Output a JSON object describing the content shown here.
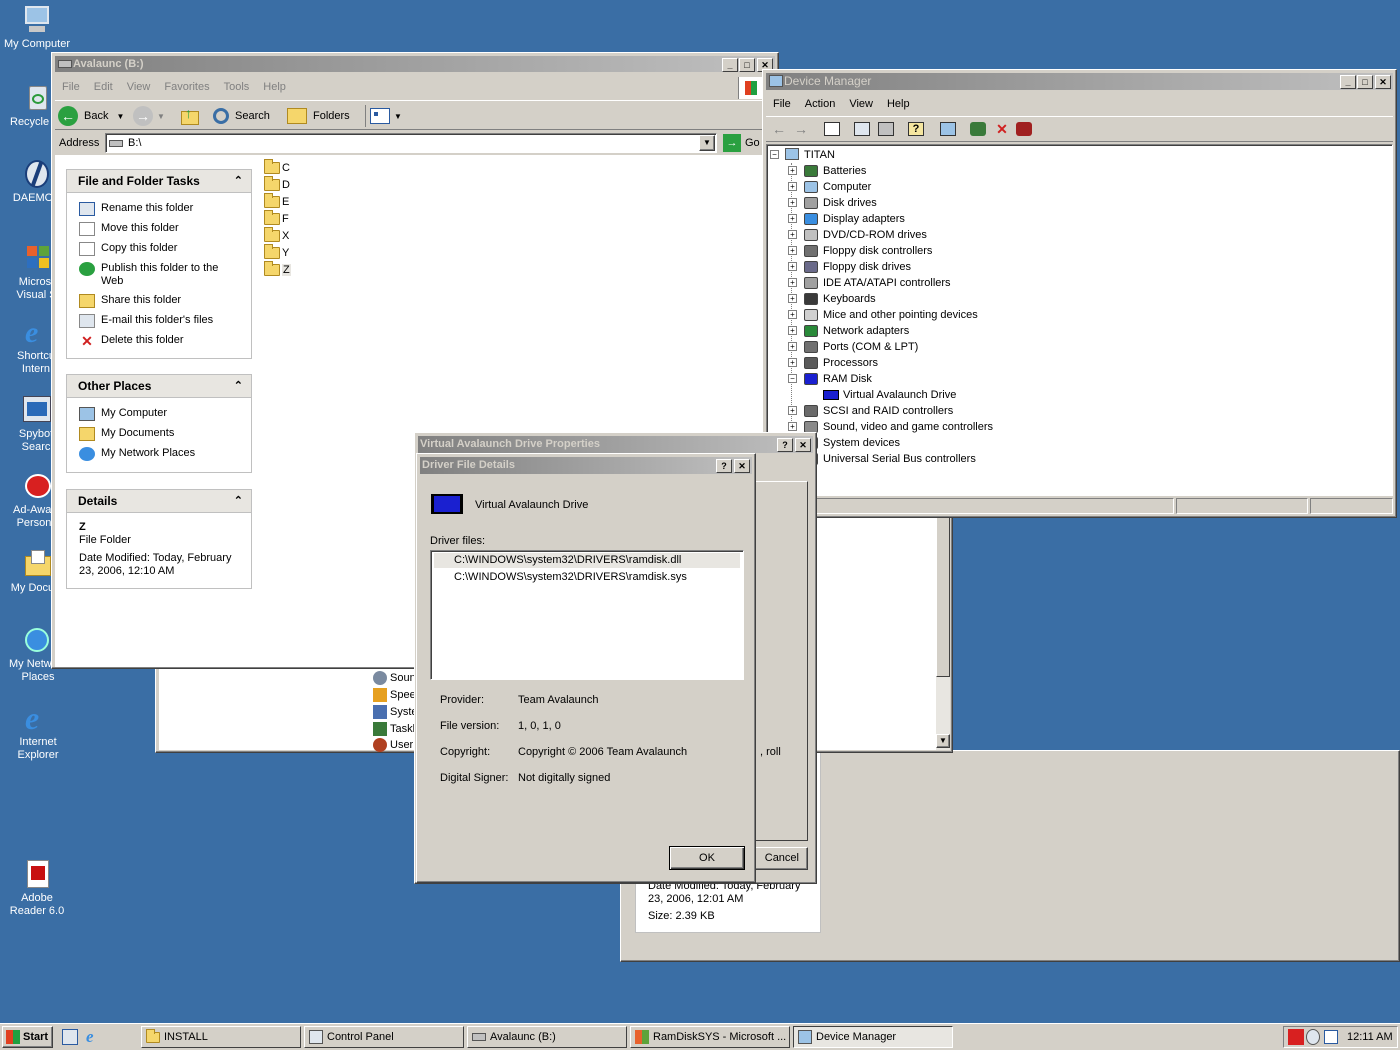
{
  "desktop": {
    "icons": [
      {
        "name": "my-computer",
        "label": "My Computer"
      },
      {
        "name": "recycle-bin",
        "label": "Recycle"
      },
      {
        "name": "daemon",
        "label": "DAEMON"
      },
      {
        "name": "visual-studio",
        "label": "Microso Visual St"
      },
      {
        "name": "shortcut-internet",
        "label": "Shortcu Intern"
      },
      {
        "name": "spybot",
        "label": "Spybot Searc"
      },
      {
        "name": "ad-aware",
        "label": "Ad-Awar Person"
      },
      {
        "name": "my-documents",
        "label": "My Docum"
      },
      {
        "name": "my-network-places",
        "label": "My Network Places"
      },
      {
        "name": "internet-explorer",
        "label": "Internet Explorer"
      },
      {
        "name": "adobe-reader",
        "label": "Adobe Reader 6.0"
      }
    ]
  },
  "explorer": {
    "title": "Avalaunc (B:)",
    "menu": [
      "File",
      "Edit",
      "View",
      "Favorites",
      "Tools",
      "Help"
    ],
    "toolbar": {
      "back": "Back",
      "search": "Search",
      "folders": "Folders"
    },
    "address_label": "Address",
    "address_value": "B:\\",
    "go_label": "Go",
    "folders": [
      "C",
      "D",
      "E",
      "F",
      "X",
      "Y",
      "Z"
    ],
    "tasks": {
      "title": "File and Folder Tasks",
      "items": [
        "Rename this folder",
        "Move this folder",
        "Copy this folder",
        "Publish this folder to the Web",
        "Share this folder",
        "E-mail this folder's files",
        "Delete this folder"
      ]
    },
    "other_places": {
      "title": "Other Places",
      "items": [
        "My Computer",
        "My Documents",
        "My Network Places"
      ]
    },
    "details": {
      "title": "Details",
      "name": "Z",
      "type": "File Folder",
      "modified": "Date Modified: Today, February 23, 2006, 12:10 AM"
    }
  },
  "control_panel": {
    "items": [
      "Soun",
      "Spee",
      "Syste",
      "Taskl",
      "User"
    ]
  },
  "background_details": {
    "modified": "Date Modified: Today, February 23, 2006, 12:01 AM",
    "size": "Size: 2.39 KB"
  },
  "device_manager": {
    "title": "Device Manager",
    "menu": [
      "File",
      "Action",
      "View",
      "Help"
    ],
    "root": "TITAN",
    "nodes": [
      "Batteries",
      "Computer",
      "Disk drives",
      "Display adapters",
      "DVD/CD-ROM drives",
      "Floppy disk controllers",
      "Floppy disk drives",
      "IDE ATA/ATAPI controllers",
      "Keyboards",
      "Mice and other pointing devices",
      "Network adapters",
      "Ports (COM & LPT)",
      "Processors",
      "RAM Disk",
      "SCSI and RAID controllers",
      "Sound, video and game controllers",
      "System devices",
      "Universal Serial Bus controllers"
    ],
    "expanded_child": "Virtual Avalaunch Drive"
  },
  "properties": {
    "title": "Virtual Avalaunch Drive Properties",
    "partial_text": ", roll",
    "cancel": "Cancel"
  },
  "driver_details": {
    "title": "Driver File Details",
    "device_name": "Virtual Avalaunch Drive",
    "files_label": "Driver files:",
    "files": [
      "C:\\WINDOWS\\system32\\DRIVERS\\ramdisk.dll",
      "C:\\WINDOWS\\system32\\DRIVERS\\ramdisk.sys"
    ],
    "fields": [
      {
        "label": "Provider:",
        "value": "Team Avalaunch"
      },
      {
        "label": "File version:",
        "value": "1, 0, 1, 0"
      },
      {
        "label": "Copyright:",
        "value": "Copyright © 2006 Team Avalaunch"
      },
      {
        "label": "Digital Signer:",
        "value": "Not digitally signed"
      }
    ],
    "ok": "OK"
  },
  "taskbar": {
    "start": "Start",
    "buttons": [
      "INSTALL",
      "Control Panel",
      "Avalaunc (B:)",
      "RamDiskSYS - Microsoft ...",
      "Device Manager"
    ],
    "clock": "12:11 AM"
  }
}
